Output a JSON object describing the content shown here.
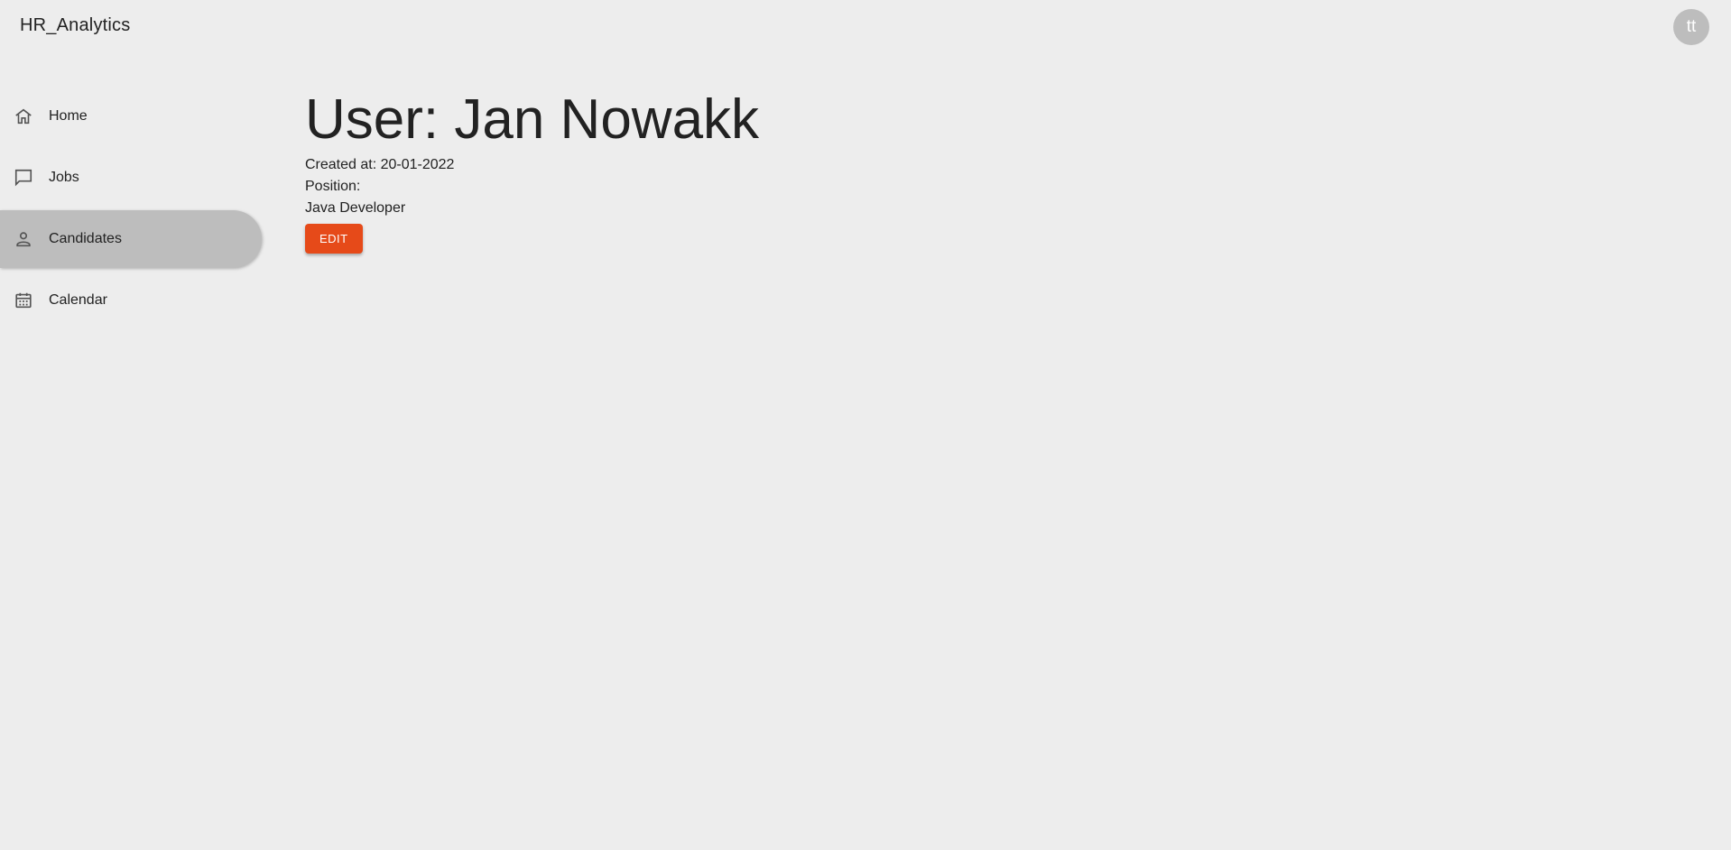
{
  "app": {
    "title": "HR_Analytics",
    "avatar_initials": "tt"
  },
  "sidebar": {
    "items": [
      {
        "label": "Home",
        "icon": "home-icon",
        "active": false
      },
      {
        "label": "Jobs",
        "icon": "chat-icon",
        "active": false
      },
      {
        "label": "Candidates",
        "icon": "person-icon",
        "active": true
      },
      {
        "label": "Calendar",
        "icon": "calendar-icon",
        "active": false
      }
    ]
  },
  "main": {
    "title": "User: Jan Nowakk",
    "created_at": "Created at: 20-01-2022",
    "position_label": "Position:",
    "position_value": "Java Developer",
    "edit_label": "EDIT"
  },
  "colors": {
    "background": "#ededed",
    "active_nav": "#bdbdbd",
    "accent_button": "#e64a19",
    "avatar": "#bdbdbd"
  }
}
